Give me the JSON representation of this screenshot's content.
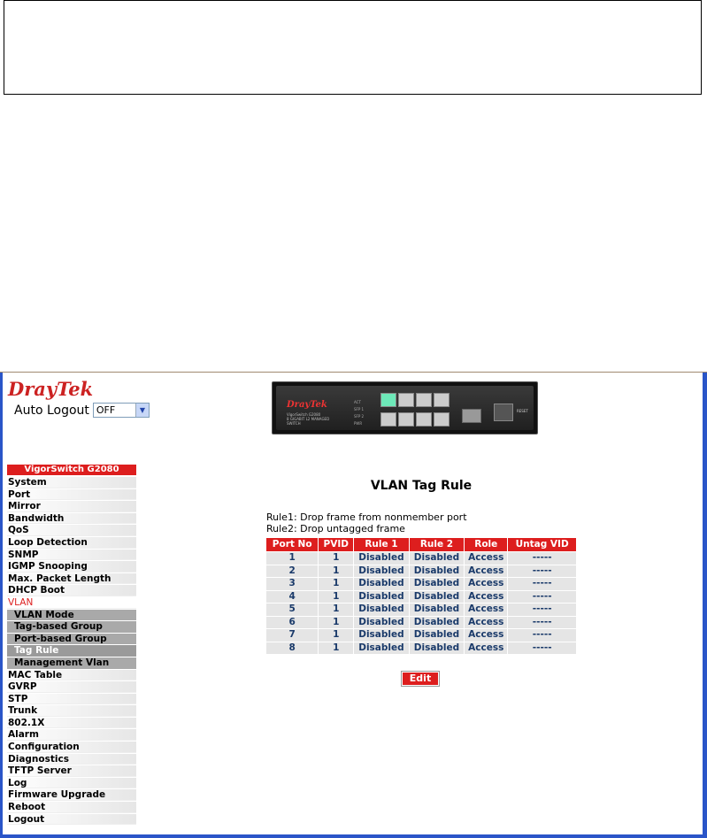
{
  "brand": {
    "logo_text": "DrayTek"
  },
  "auto_logout": {
    "label": "Auto Logout",
    "selected": "OFF"
  },
  "device": {
    "logo": "DrayTek",
    "model": "VigorSwitch G2080",
    "subtitle": "8 GIGABIT L2 MANAGED SWITCH",
    "leds": [
      "ACT",
      "SFP 1",
      "SFP 2",
      "PWR"
    ],
    "sfp_label": "SFP",
    "reset_label": "RESET"
  },
  "sidebar": {
    "header": "VigorSwitch G2080",
    "items_before": [
      "System",
      "Port",
      "Mirror",
      "Bandwidth",
      "QoS",
      "Loop Detection",
      "SNMP",
      "IGMP Snooping",
      "Max. Packet Length",
      "DHCP Boot"
    ],
    "active_item": "VLAN",
    "subitems": [
      "VLAN Mode",
      "Tag-based Group",
      "Port-based Group",
      "Tag Rule",
      "Management Vlan"
    ],
    "active_subitem": "Tag Rule",
    "items_after": [
      "MAC Table",
      "GVRP",
      "STP",
      "Trunk",
      "802.1X",
      "Alarm",
      "Configuration",
      "Diagnostics",
      "TFTP Server",
      "Log",
      "Firmware Upgrade",
      "Reboot",
      "Logout"
    ]
  },
  "main": {
    "title": "VLAN Tag Rule",
    "rule1": "Rule1: Drop frame from nonmember port",
    "rule2": "Rule2: Drop untagged frame",
    "columns": [
      "Port No",
      "PVID",
      "Rule 1",
      "Rule 2",
      "Role",
      "Untag VID"
    ],
    "rows": [
      [
        "1",
        "1",
        "Disabled",
        "Disabled",
        "Access",
        "-----"
      ],
      [
        "2",
        "1",
        "Disabled",
        "Disabled",
        "Access",
        "-----"
      ],
      [
        "3",
        "1",
        "Disabled",
        "Disabled",
        "Access",
        "-----"
      ],
      [
        "4",
        "1",
        "Disabled",
        "Disabled",
        "Access",
        "-----"
      ],
      [
        "5",
        "1",
        "Disabled",
        "Disabled",
        "Access",
        "-----"
      ],
      [
        "6",
        "1",
        "Disabled",
        "Disabled",
        "Access",
        "-----"
      ],
      [
        "7",
        "1",
        "Disabled",
        "Disabled",
        "Access",
        "-----"
      ],
      [
        "8",
        "1",
        "Disabled",
        "Disabled",
        "Access",
        "-----"
      ]
    ],
    "edit_label": "Edit"
  },
  "colors": {
    "accent": "#dd1e1e",
    "frame": "#2a55c8",
    "cell_text": "#1a3a6a",
    "cell_bg": "#e5e5e5",
    "submenu_bg": "#a9a9a9"
  }
}
